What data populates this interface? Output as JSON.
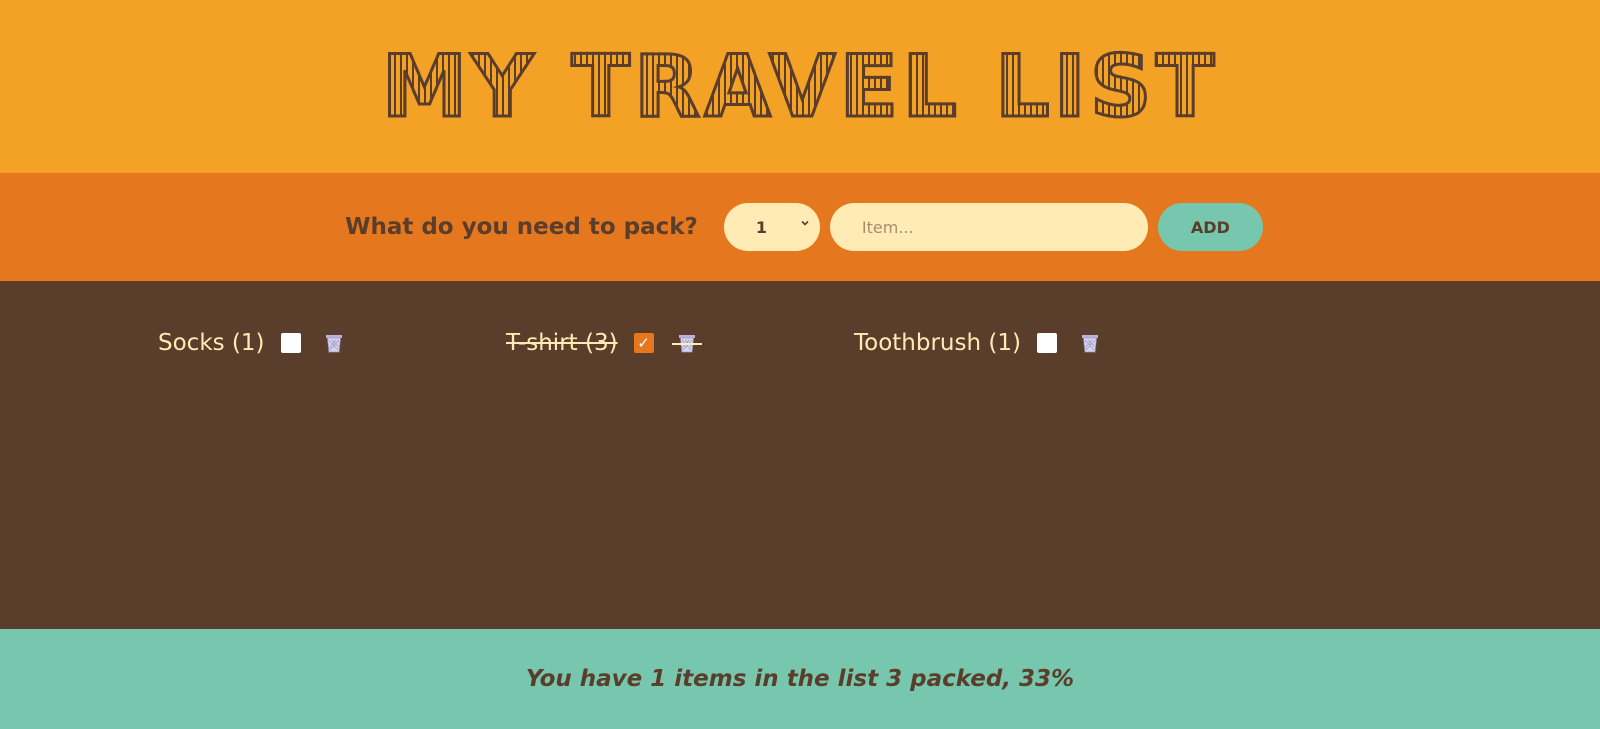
{
  "header": {
    "title": "My Travel List"
  },
  "form": {
    "label": "What do you need to pack?",
    "quantity_value": "1",
    "item_placeholder": "Item...",
    "item_value": "",
    "add_label": "ADD"
  },
  "items": [
    {
      "label": "Socks (1)",
      "packed": false
    },
    {
      "label": "T-shirt (3)",
      "packed": true
    },
    {
      "label": "Toothbrush (1)",
      "packed": false
    }
  ],
  "stats": {
    "text": "You have 1 items in the list 3 packed, 33%"
  },
  "colors": {
    "header_bg": "#f4a226",
    "form_bg": "#e5771e",
    "list_bg": "#5a3e2b",
    "stats_bg": "#76c7ad",
    "text_light": "#ffebb3"
  },
  "icons": {
    "delete": "trash-icon",
    "select_arrow": "chevron-down-icon"
  }
}
